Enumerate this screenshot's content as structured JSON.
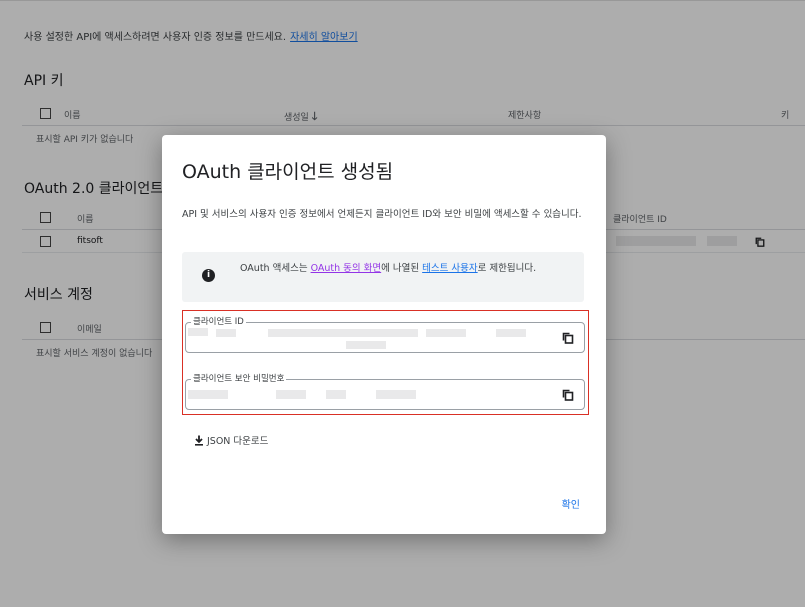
{
  "intro": {
    "text": "사용 설정한 API에 액세스하려면 사용자 인증 정보를 만드세요.",
    "link": "자세히 알아보기"
  },
  "api_keys": {
    "title": "API 키",
    "columns": [
      "이름",
      "생성일",
      "제한사항",
      "키"
    ],
    "empty": "표시할 API 키가 없습니다"
  },
  "oauth": {
    "title": "OAuth 2.0 클라이언트",
    "columns": [
      "이름",
      "클라이언트 ID"
    ],
    "rows": [
      {
        "name": "fitsoft"
      }
    ]
  },
  "service_accounts": {
    "title": "서비스 계정",
    "columns": [
      "이메일"
    ],
    "empty": "표시할 서비스 계정이 없습니다"
  },
  "dialog": {
    "title": "OAuth 클라이언트 생성됨",
    "description": "API 및 서비스의 사용자 인증 정보에서 언제든지 클라이언트 ID와 보안 비밀에 액세스할 수 있습니다.",
    "info": {
      "icon": "info-icon",
      "prefix": "OAuth 액세스는 ",
      "link1": "OAuth 동의 화면",
      "middle": "에 나열된 ",
      "link2": "테스트 사용자",
      "suffix": "로 제한됩니다."
    },
    "client_id_label": "클라이언트 ID",
    "client_secret_label": "클라이언트 보안 비밀번호",
    "download_label": "JSON 다운로드",
    "confirm_label": "확인"
  },
  "colors": {
    "link": "#1a73e8",
    "link_visited": "#9334e6",
    "highlight": "#d93025",
    "scrim": "rgba(0,0,0,0.32)"
  }
}
